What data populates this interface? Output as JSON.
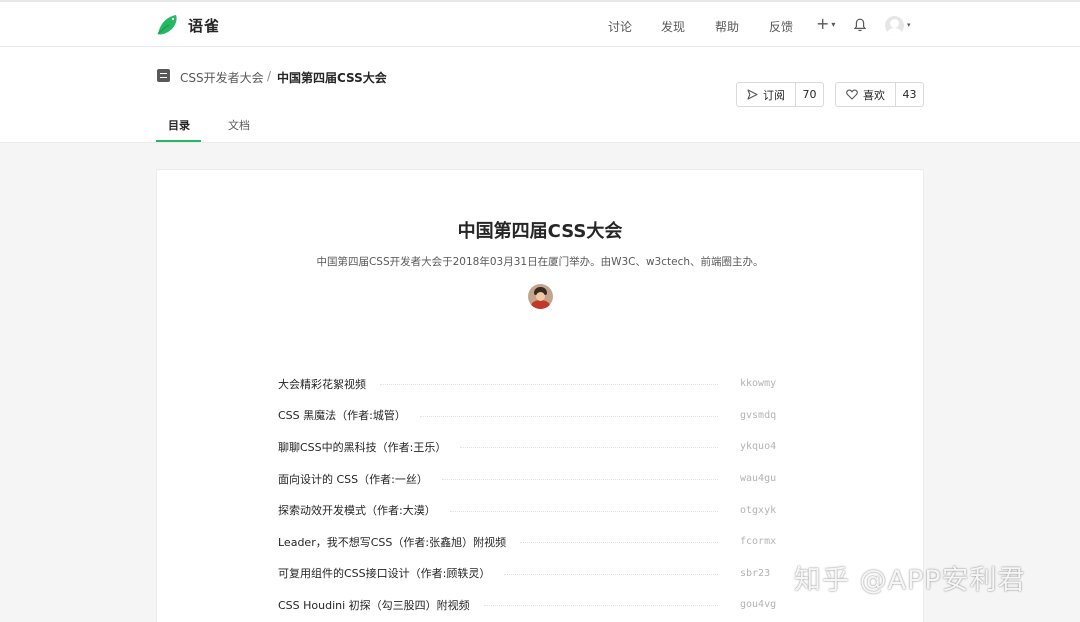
{
  "app": {
    "name": "语雀",
    "brand_color": "#25b864"
  },
  "nav": {
    "items": [
      "讨论",
      "发现",
      "帮助",
      "反馈"
    ],
    "plus": "+"
  },
  "breadcrumb": {
    "group": "CSS开发者大会",
    "separator": "/",
    "book": "中国第四届CSS大会"
  },
  "actions": {
    "subscribe_label": "订阅",
    "subscribe_count": "70",
    "like_label": "喜欢",
    "like_count": "43"
  },
  "tabs": {
    "toc": "目录",
    "docs": "文档",
    "active": "toc"
  },
  "book": {
    "title": "中国第四届CSS大会",
    "description": "中国第四届CSS开发者大会于2018年03月31日在厦门举办。由W3C、w3ctech、前端圈主办。"
  },
  "toc": [
    {
      "title": "大会精彩花絮视频",
      "slug": "kkowmy"
    },
    {
      "title": "CSS 黑魔法（作者:城管）",
      "slug": "gvsmdq"
    },
    {
      "title": "聊聊CSS中的黑科技（作者:王乐）",
      "slug": "ykquo4"
    },
    {
      "title": "面向设计的 CSS（作者:一丝）",
      "slug": "wau4gu"
    },
    {
      "title": "探索动效开发模式（作者:大漠）",
      "slug": "otgxyk"
    },
    {
      "title": "Leader，我不想写CSS（作者:张鑫旭）附视频",
      "slug": "fcormx"
    },
    {
      "title": "可复用组件的CSS接口设计（作者:顾轶灵）",
      "slug": "sbr23"
    },
    {
      "title": "CSS Houdini 初探（勾三股四）附视频",
      "slug": "gou4vg"
    }
  ],
  "watermark": "知乎 @APP安利君",
  "icons": {
    "logo": "yuque-bird-logo",
    "book": "book-icon",
    "bell": "bell-icon",
    "subscribe": "send-icon",
    "like": "heart-icon"
  }
}
